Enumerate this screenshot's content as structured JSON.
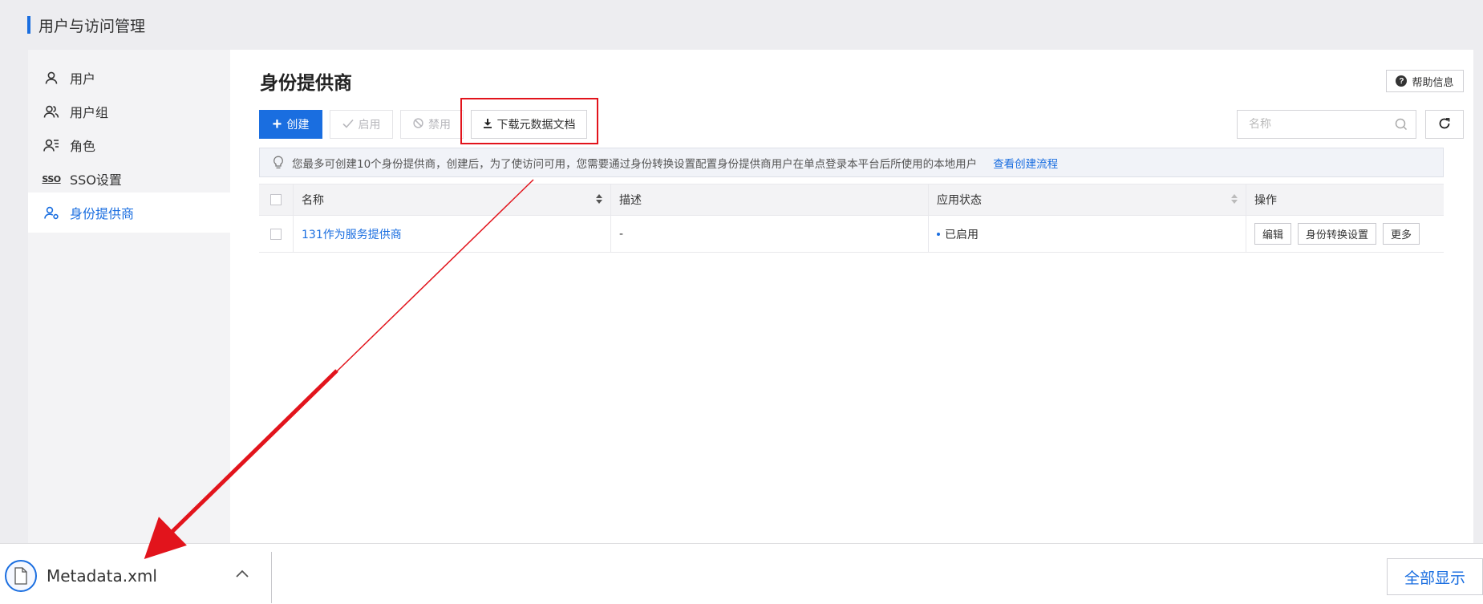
{
  "app": {
    "title": "用户与访问管理"
  },
  "sidebar": {
    "items": [
      {
        "label": "用户",
        "icon": "user-icon"
      },
      {
        "label": "用户组",
        "icon": "user-group-icon"
      },
      {
        "label": "角色",
        "icon": "role-icon"
      },
      {
        "label": "SSO设置",
        "icon": "sso-icon",
        "icon_text": "SSO"
      },
      {
        "label": "身份提供商",
        "icon": "identity-provider-icon",
        "active": true
      }
    ]
  },
  "main": {
    "title": "身份提供商",
    "help_label": "帮助信息",
    "toolbar": {
      "create_label": "创建",
      "enable_label": "启用",
      "disable_label": "禁用",
      "download_label": "下载元数据文档"
    },
    "search": {
      "placeholder": "名称",
      "value": ""
    },
    "notice": {
      "text": "您最多可创建10个身份提供商，创建后，为了使访问可用，您需要通过身份转换设置配置身份提供商用户在单点登录本平台后所使用的本地用户",
      "link": "查看创建流程"
    },
    "table": {
      "columns": [
        "名称",
        "描述",
        "应用状态",
        "操作"
      ],
      "rows": [
        {
          "name": "131作为服务提供商",
          "description": "-",
          "status": "已启用",
          "actions": [
            "编辑",
            "身份转换设置",
            "更多"
          ]
        }
      ]
    }
  },
  "download_bar": {
    "file_name": "Metadata.xml",
    "show_all_label": "全部显示"
  },
  "colors": {
    "accent": "#1a6ee0",
    "highlight": "#e2141c"
  }
}
